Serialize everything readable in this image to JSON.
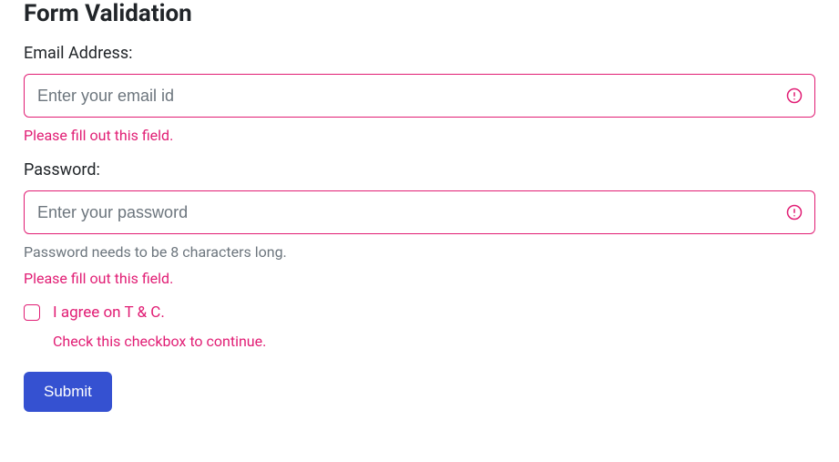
{
  "title": "Form Validation",
  "email": {
    "label": "Email Address:",
    "placeholder": "Enter your email id",
    "value": "",
    "error": "Please fill out this field."
  },
  "password": {
    "label": "Password:",
    "placeholder": "Enter your password",
    "value": "",
    "help": "Password needs to be 8 characters long.",
    "error": "Please fill out this field."
  },
  "terms": {
    "label": "I agree on T & C.",
    "checked": false,
    "error": "Check this checkbox to continue."
  },
  "submit": {
    "label": "Submit"
  },
  "colors": {
    "error": "#e11d74",
    "primary": "#3551d1",
    "muted": "#6c757d"
  }
}
